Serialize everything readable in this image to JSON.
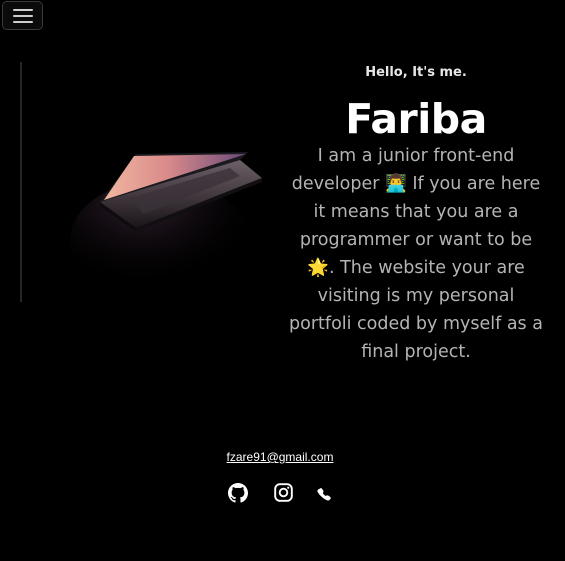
{
  "nav": {
    "toggler_icon": "hamburger-menu-icon"
  },
  "hero": {
    "image_icon": "laptop-photo",
    "greeting": "Hello, It's me.",
    "name": "Fariba",
    "bio": "I am a junior front-end developer 👨‍💻 If you are here it means that you are a programmer or want to be 🌟. The website your are visiting is my personal portfoli coded by myself as a final project."
  },
  "contact": {
    "email": "fzare91@gmail.com",
    "socials": [
      {
        "icon": "github-icon"
      },
      {
        "icon": "instagram-icon"
      },
      {
        "icon": "phone-icon"
      }
    ]
  },
  "colors": {
    "background": "#000000",
    "heading": "#ffffff",
    "bio_text": "#b4b4b4"
  }
}
